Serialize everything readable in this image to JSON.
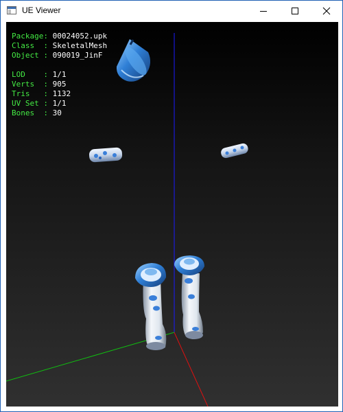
{
  "window": {
    "title": "UE Viewer"
  },
  "info": {
    "package": {
      "label": "Package: ",
      "value": "00024052.upk"
    },
    "class": {
      "label": "Class  : ",
      "value": "SkeletalMesh"
    },
    "object": {
      "label": "Object : ",
      "value": "090019_JinF"
    },
    "lod": {
      "label": "LOD    : ",
      "value": "1/1"
    },
    "verts": {
      "label": "Verts  : ",
      "value": "905"
    },
    "tris": {
      "label": "Tris   : ",
      "value": "1132"
    },
    "uvset": {
      "label": "UV Set : ",
      "value": "1/1"
    },
    "bones": {
      "label": "Bones  : ",
      "value": "30"
    }
  },
  "colors": {
    "label_text": "#44ea44",
    "value_text": "#ffffff",
    "axis_x": "#e01010",
    "axis_y": "#10c010",
    "axis_z": "#1a1aff",
    "mesh_blue": "#3a8ee0",
    "mesh_white": "#e8eef6",
    "window_border": "#1e5fb4"
  },
  "icons": {
    "app": "window-app-icon",
    "minimize": "minimize-icon",
    "maximize": "maximize-icon",
    "close": "close-icon"
  }
}
